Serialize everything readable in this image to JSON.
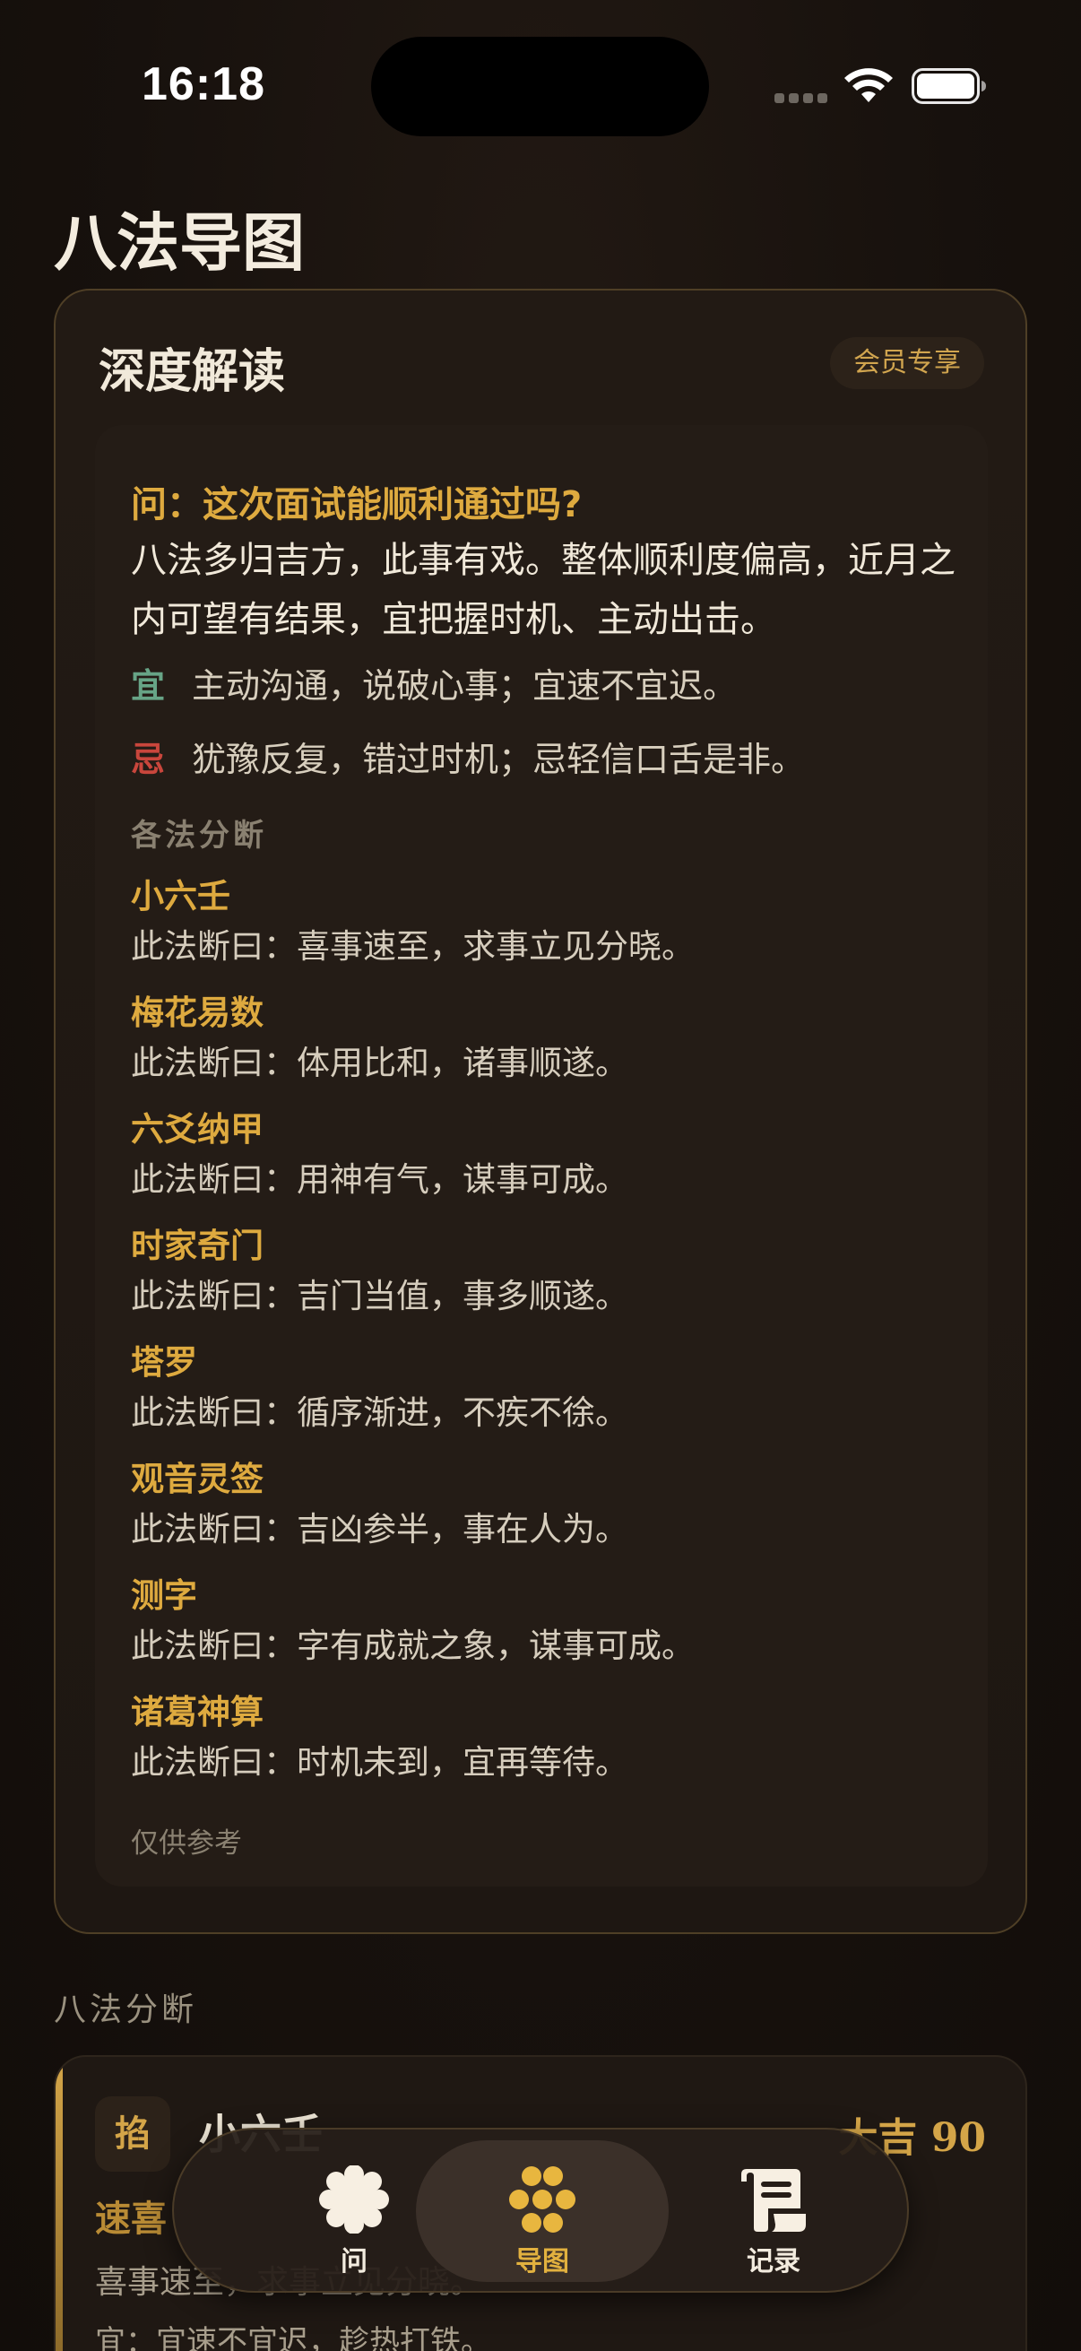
{
  "status_bar": {
    "time": "16:18"
  },
  "page": {
    "title": "八法导图"
  },
  "deep_reading": {
    "title": "深度解读",
    "badge": "会员专享",
    "question": "问：这次面试能顺利通过吗?",
    "summary": "八法多归吉方，此事有戏。整体顺利度偏高，近月之内可望有结果，宜把握时机、主动出击。",
    "yi": {
      "tag": "宜",
      "text": "主动沟通，说破心事；宜速不宜迟。"
    },
    "ji": {
      "tag": "忌",
      "text": "犹豫反复，错过时机；忌轻信口舌是非。"
    },
    "section_label": "各法分断",
    "methods": [
      {
        "name": "小六壬",
        "desc": "此法断曰：喜事速至，求事立见分晓。"
      },
      {
        "name": "梅花易数",
        "desc": "此法断曰：体用比和，诸事顺遂。"
      },
      {
        "name": "六爻纳甲",
        "desc": "此法断曰：用神有气，谋事可成。"
      },
      {
        "name": "时家奇门",
        "desc": "此法断曰：吉门当值，事多顺遂。"
      },
      {
        "name": "塔罗",
        "desc": "此法断曰：循序渐进，不疾不徐。"
      },
      {
        "name": "观音灵签",
        "desc": "此法断曰：吉凶参半，事在人为。"
      },
      {
        "name": "测字",
        "desc": "此法断曰：字有成就之象，谋事可成。"
      },
      {
        "name": "诸葛神算",
        "desc": "此法断曰：时机未到，宜再等待。"
      }
    ],
    "disclaimer": "仅供参考"
  },
  "eight_methods": {
    "heading": "八法分断",
    "card": {
      "char": "掐",
      "name": "小六壬",
      "score": "大吉 90",
      "keyword": "速喜",
      "desc": "喜事速至，求事立见分晓。",
      "advice": "宜：宜速不宜迟，趁热打铁。"
    }
  },
  "tab_bar": {
    "items": [
      {
        "label": "问",
        "icon": "flower-badge-icon",
        "active": false
      },
      {
        "label": "导图",
        "icon": "flower-cluster-icon",
        "active": true
      },
      {
        "label": "记录",
        "icon": "scroll-icon",
        "active": false
      }
    ]
  },
  "colors": {
    "accent_gold": "#deaa3f",
    "yi_green": "#67a486",
    "ji_red": "#c9463c",
    "background": "#17110d"
  }
}
